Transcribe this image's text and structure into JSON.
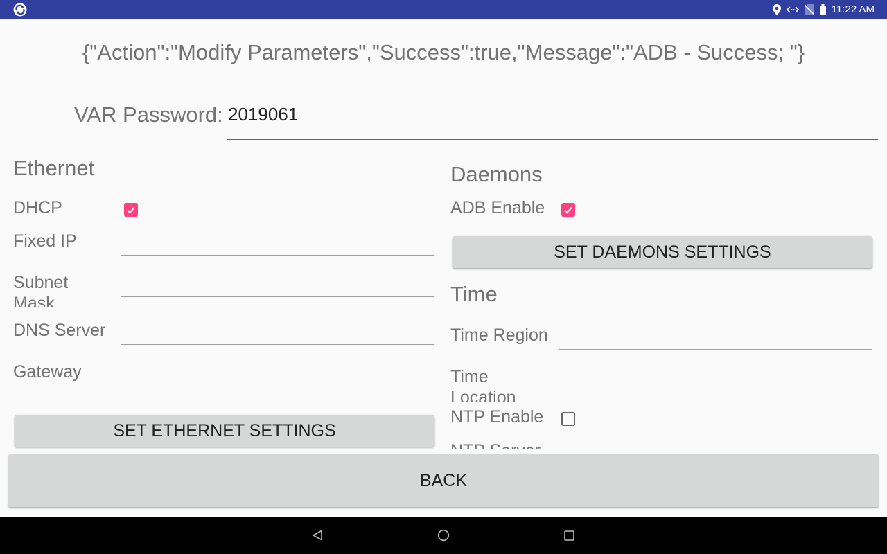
{
  "status_bar": {
    "time": "11:22 AM",
    "icons": [
      "app-logo-icon",
      "location-icon",
      "data-arrows-icon",
      "no-sim-icon",
      "battery-icon"
    ]
  },
  "response_message": "{\"Action\":\"Modify Parameters\",\"Success\":true,\"Message\":\"ADB - Success; \"}",
  "password": {
    "label": "VAR Password:",
    "value": "2019061"
  },
  "ethernet": {
    "heading": "Ethernet",
    "dhcp_label": "DHCP",
    "dhcp_checked": true,
    "fixed_ip_label": "Fixed IP",
    "fixed_ip_value": "",
    "subnet_mask_label": "Subnet Mask",
    "subnet_mask_value": "",
    "dns_server_label": "DNS Server",
    "dns_server_value": "",
    "gateway_label": "Gateway",
    "gateway_value": "",
    "button_label": "SET ETHERNET SETTINGS"
  },
  "daemons": {
    "heading": "Daemons",
    "adb_enable_label": "ADB Enable",
    "adb_enable_checked": true,
    "button_label": "SET DAEMONS SETTINGS"
  },
  "time": {
    "heading": "Time",
    "time_region_label": "Time Region",
    "time_region_value": "",
    "time_location_label": "Time Location",
    "time_location_value": "",
    "ntp_enable_label": "NTP Enable",
    "ntp_enable_checked": false,
    "ntp_server_label": "NTP Server"
  },
  "back_button_label": "BACK",
  "nav_bar": {
    "icons": [
      "back-nav-icon",
      "home-nav-icon",
      "recents-nav-icon"
    ]
  },
  "colors": {
    "status_bar": "#303f9f",
    "accent": "#ff4081",
    "underline_focus": "#e91e63",
    "button": "#d6d7d7"
  }
}
